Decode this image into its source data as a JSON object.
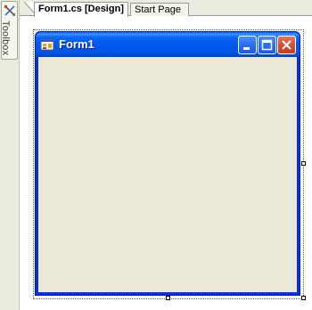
{
  "toolbox": {
    "label": "Toolbox",
    "icon": "toolbox-icon"
  },
  "tabs": [
    {
      "label": "Form1.cs [Design]",
      "active": true
    },
    {
      "label": "Start Page",
      "active": false
    }
  ],
  "form": {
    "title": "Form1",
    "icon": "form-icon",
    "buttons": {
      "minimize": "minimize-icon",
      "maximize": "maximize-icon",
      "close": "close-icon"
    },
    "client_color": "#ece9d8",
    "titlebar_color": "#0058ee"
  }
}
